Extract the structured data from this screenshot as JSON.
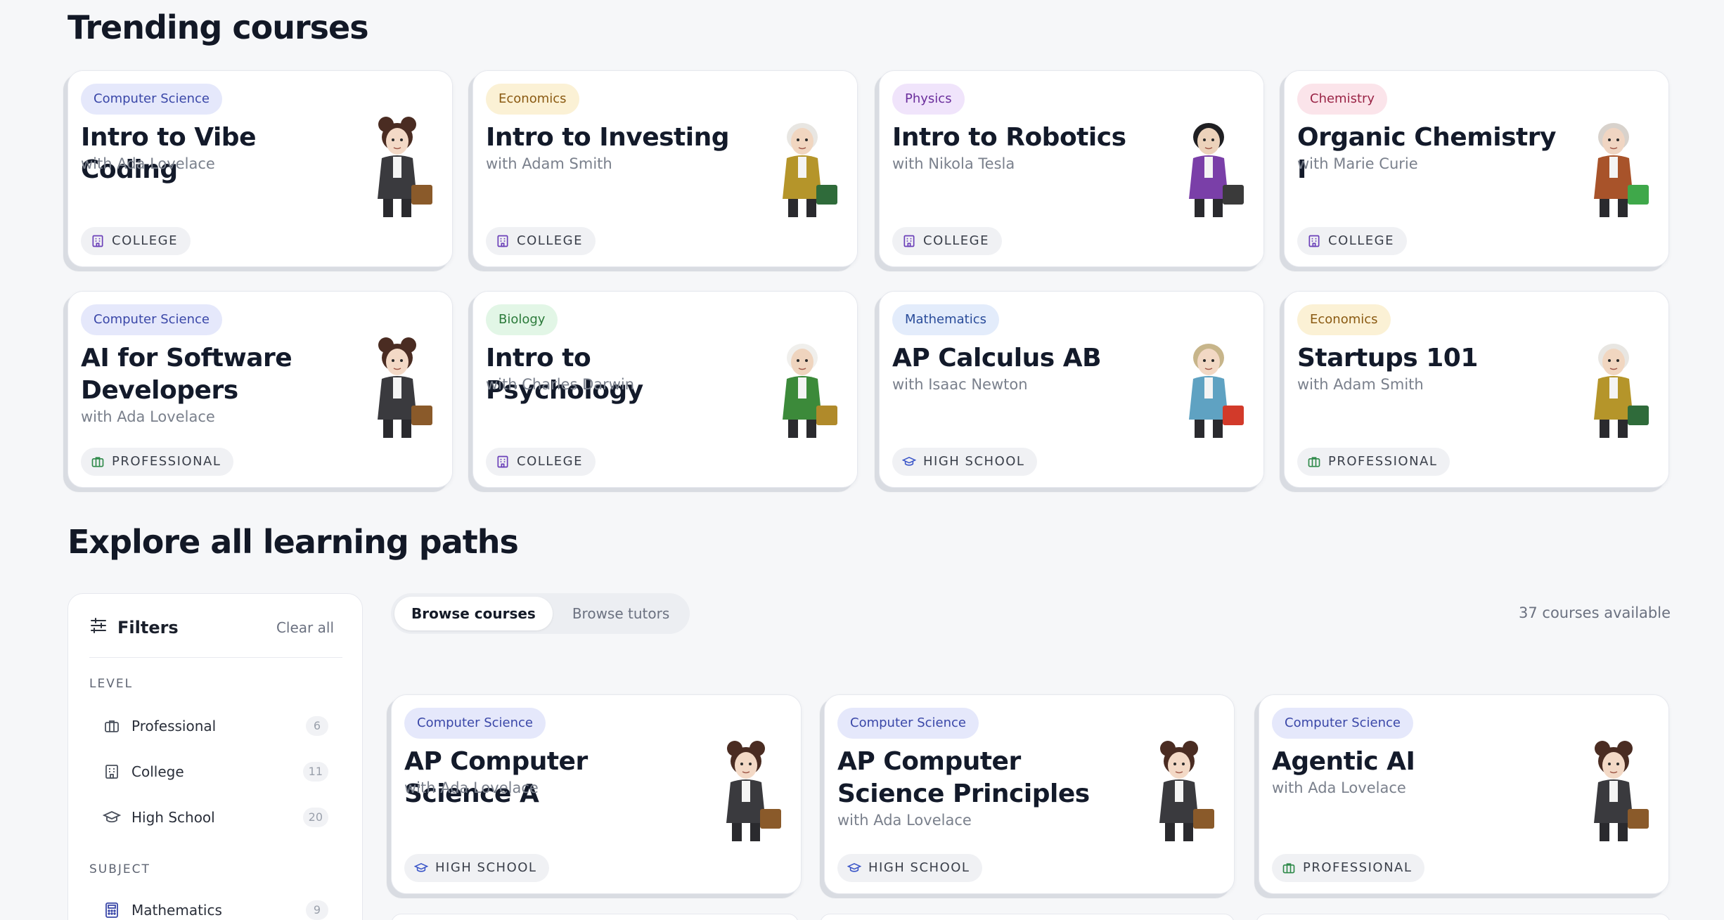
{
  "sections": {
    "trending_title": "Trending courses",
    "explore_title": "Explore all learning paths"
  },
  "trending": [
    {
      "subject": "Computer Science",
      "title": "Intro to Vibe Coding",
      "tutor": "with Ada Lovelace",
      "level": "COLLEGE",
      "avatar": "ada-lovelace"
    },
    {
      "subject": "Economics",
      "title": "Intro to Investing",
      "tutor": "with Adam Smith",
      "level": "COLLEGE",
      "avatar": "adam-smith"
    },
    {
      "subject": "Physics",
      "title": "Intro to Robotics",
      "tutor": "with Nikola Tesla",
      "level": "COLLEGE",
      "avatar": "nikola-tesla"
    },
    {
      "subject": "Chemistry",
      "title": "Organic Chemistry I",
      "tutor": "with Marie Curie",
      "level": "COLLEGE",
      "avatar": "marie-curie"
    },
    {
      "subject": "Computer Science",
      "title": "AI for Software Developers",
      "tutor": "with Ada Lovelace",
      "level": "PROFESSIONAL",
      "avatar": "ada-lovelace"
    },
    {
      "subject": "Biology",
      "title": "Intro to Psychology",
      "tutor": "with Charles Darwin",
      "level": "COLLEGE",
      "avatar": "charles-darwin"
    },
    {
      "subject": "Mathematics",
      "title": "AP Calculus AB",
      "tutor": "with Isaac Newton",
      "level": "HIGH SCHOOL",
      "avatar": "isaac-newton"
    },
    {
      "subject": "Economics",
      "title": "Startups 101",
      "tutor": "with Adam Smith",
      "level": "PROFESSIONAL",
      "avatar": "adam-smith"
    }
  ],
  "filters": {
    "title": "Filters",
    "clear_label": "Clear all",
    "level_heading": "LEVEL",
    "levels": [
      {
        "label": "Professional",
        "count": "6"
      },
      {
        "label": "College",
        "count": "11"
      },
      {
        "label": "High School",
        "count": "20"
      }
    ],
    "subject_heading": "SUBJECT",
    "subjects": [
      {
        "label": "Mathematics",
        "count": "9"
      }
    ]
  },
  "tabs": {
    "courses": "Browse courses",
    "tutors": "Browse tutors"
  },
  "courses_count": "37 courses available",
  "courses": [
    {
      "subject": "Computer Science",
      "title": "AP Computer Science A",
      "tutor": "with Ada Lovelace",
      "level": "HIGH SCHOOL",
      "avatar": "ada-lovelace"
    },
    {
      "subject": "Computer Science",
      "title": "AP Computer Science Principles",
      "tutor": "with Ada Lovelace",
      "level": "HIGH SCHOOL",
      "avatar": "ada-lovelace"
    },
    {
      "subject": "Computer Science",
      "title": "Agentic AI",
      "tutor": "with Ada Lovelace",
      "level": "PROFESSIONAL",
      "avatar": "ada-lovelace"
    }
  ],
  "colors": {
    "cs": "#3a47a8",
    "economics": "#8a5a12",
    "physics": "#6b2e9c",
    "chemistry": "#9a2446",
    "biology": "#2b7a3a",
    "mathematics": "#2a4c9a"
  }
}
